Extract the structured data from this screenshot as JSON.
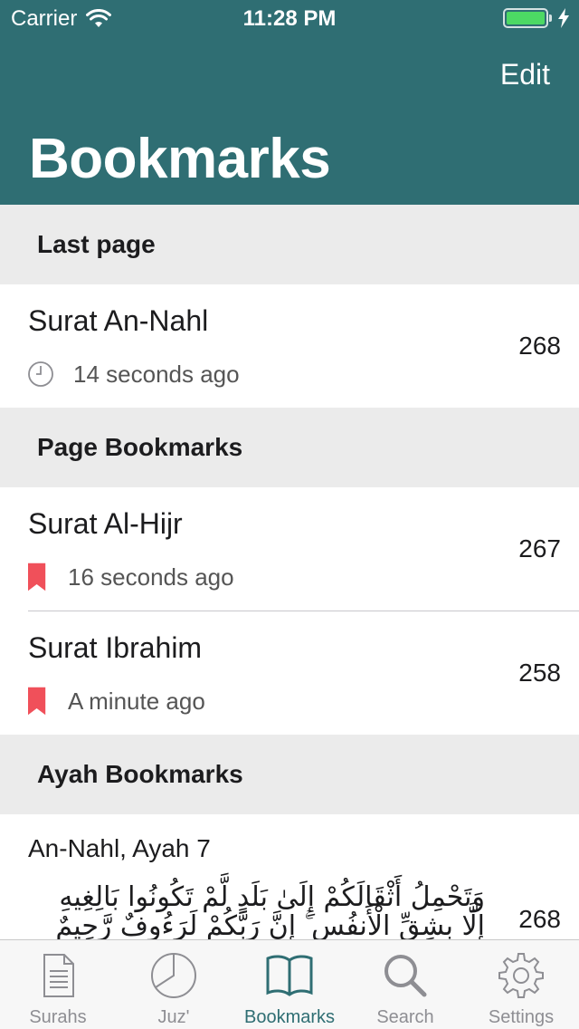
{
  "status": {
    "carrier": "Carrier",
    "time": "11:28 PM"
  },
  "header": {
    "edit_label": "Edit",
    "title": "Bookmarks"
  },
  "sections": {
    "last_page": {
      "header": "Last page",
      "item": {
        "title": "Surat An-Nahl",
        "time": "14 seconds ago",
        "page": "268",
        "icon": "clock-icon"
      }
    },
    "page_bookmarks": {
      "header": "Page Bookmarks",
      "items": [
        {
          "title": "Surat Al-Hijr",
          "time": "16 seconds ago",
          "page": "267",
          "icon": "bookmark-icon"
        },
        {
          "title": "Surat Ibrahim",
          "time": "A minute ago",
          "page": "258",
          "icon": "bookmark-icon"
        }
      ]
    },
    "ayah_bookmarks": {
      "header": "Ayah Bookmarks",
      "items": [
        {
          "title": "An-Nahl, Ayah 7",
          "text": "وَتَحْمِلُ أَثْقَالَكُمْ إِلَىٰ بَلَدٍ لَّمْ تَكُونُوا بَالِغِيهِ إِلَّا بِشِقِّ الْأَنفُسِ ۚ إِنَّ رَبَّكُمْ لَرَءُوفٌ رَّحِيمٌ",
          "page": "268"
        }
      ]
    }
  },
  "tabbar": {
    "tabs": [
      {
        "label": "Surahs",
        "icon": "document-icon"
      },
      {
        "label": "Juz'",
        "icon": "pie-icon"
      },
      {
        "label": "Bookmarks",
        "icon": "book-icon"
      },
      {
        "label": "Search",
        "icon": "search-icon"
      },
      {
        "label": "Settings",
        "icon": "gear-icon"
      }
    ],
    "active": "Bookmarks"
  },
  "colors": {
    "header_bg": "#2f6e73",
    "accent": "#2f6e73",
    "bookmark": "#f0505a",
    "battery": "#4cd964",
    "section_bg": "#ebebeb"
  }
}
